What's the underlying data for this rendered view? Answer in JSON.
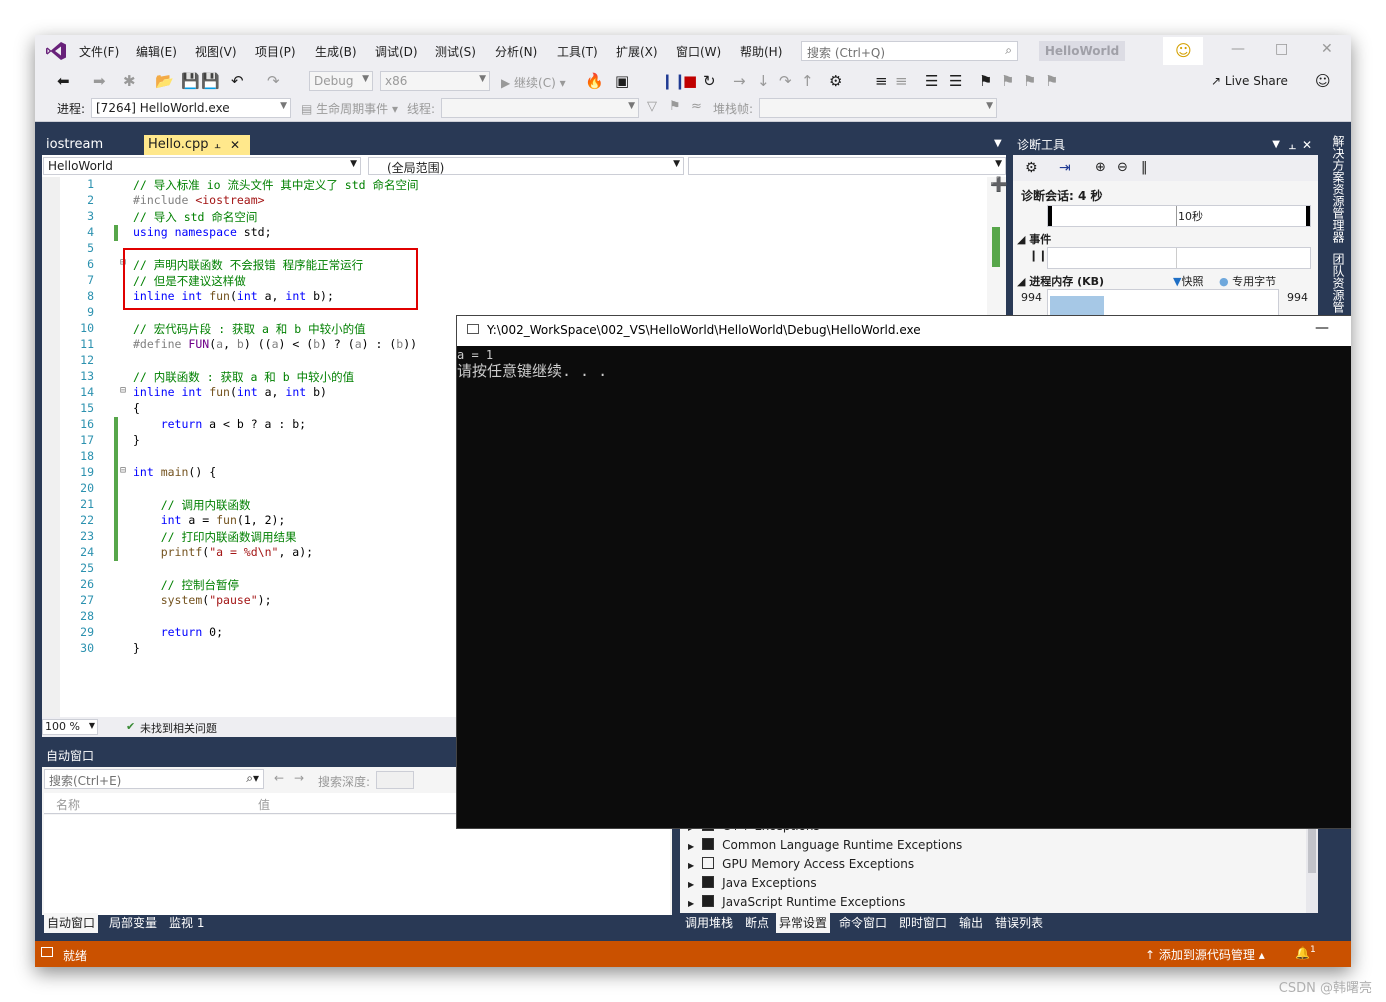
{
  "menu": [
    "文件(F)",
    "编辑(E)",
    "视图(V)",
    "项目(P)",
    "生成(B)",
    "调试(D)",
    "测试(S)",
    "分析(N)",
    "工具(T)",
    "扩展(X)",
    "窗口(W)",
    "帮助(H)"
  ],
  "search": {
    "placeholder": "搜索 (Ctrl+Q)"
  },
  "solution_name": "HelloWorld",
  "toolbar": {
    "config": "Debug",
    "platform": "x86",
    "continue_label": "继续(C)",
    "live_share": "Live Share",
    "process_label": "进程:",
    "process_value": "[7264] HelloWorld.exe",
    "lifecycle_label": "生命周期事件",
    "thread_label": "线程:",
    "stackframe_label": "堆栈帧:"
  },
  "editor": {
    "tabs": [
      "iostream",
      "Hello.cpp"
    ],
    "nav_project": "HelloWorld",
    "nav_scope": "(全局范围)",
    "zoom": "100 %",
    "issues": "未找到相关问题",
    "lines": [
      {
        "n": "1",
        "t": "// 导入标准 io 流头文件 其中定义了 std 命名空间"
      },
      {
        "n": "2",
        "t": "#include <iostream>"
      },
      {
        "n": "3",
        "t": "// 导入 std 命名空间"
      },
      {
        "n": "4",
        "t": "using namespace std;"
      },
      {
        "n": "5",
        "t": ""
      },
      {
        "n": "6",
        "t": "// 声明内联函数 不会报错 程序能正常运行"
      },
      {
        "n": "7",
        "t": "// 但是不建议这样做"
      },
      {
        "n": "8",
        "t": "inline int fun(int a, int b);"
      },
      {
        "n": "9",
        "t": ""
      },
      {
        "n": "10",
        "t": "// 宏代码片段 : 获取 a 和 b 中较小的值"
      },
      {
        "n": "11",
        "t": "#define FUN(a, b) ((a) < (b) ? (a) : (b))"
      },
      {
        "n": "12",
        "t": ""
      },
      {
        "n": "13",
        "t": "// 内联函数 : 获取 a 和 b 中较小的值"
      },
      {
        "n": "14",
        "t": "inline int fun(int a, int b)"
      },
      {
        "n": "15",
        "t": "{"
      },
      {
        "n": "16",
        "t": "    return a < b ? a : b;"
      },
      {
        "n": "17",
        "t": "}"
      },
      {
        "n": "18",
        "t": ""
      },
      {
        "n": "19",
        "t": "int main() {"
      },
      {
        "n": "20",
        "t": ""
      },
      {
        "n": "21",
        "t": "    // 调用内联函数"
      },
      {
        "n": "22",
        "t": "    int a = fun(1, 2);"
      },
      {
        "n": "23",
        "t": "    // 打印内联函数调用结果"
      },
      {
        "n": "24",
        "t": "    printf(\"a = %d\\n\", a);"
      },
      {
        "n": "25",
        "t": ""
      },
      {
        "n": "26",
        "t": "    // 控制台暂停"
      },
      {
        "n": "27",
        "t": "    system(\"pause\");"
      },
      {
        "n": "28",
        "t": ""
      },
      {
        "n": "29",
        "t": "    return 0;"
      },
      {
        "n": "30",
        "t": "}"
      }
    ]
  },
  "autos": {
    "title": "自动窗口",
    "search": "搜索(Ctrl+E)",
    "depth_label": "搜索深度:",
    "col_name": "名称",
    "col_value": "值",
    "tabs": [
      "自动窗口",
      "局部变量",
      "监视 1"
    ]
  },
  "exceptions": {
    "rows": [
      {
        "label": "C++ Exceptions",
        "checked": true
      },
      {
        "label": "Common Language Runtime Exceptions",
        "checked": true
      },
      {
        "label": "GPU Memory Access Exceptions",
        "checked": false
      },
      {
        "label": "Java Exceptions",
        "checked": true
      },
      {
        "label": "JavaScript Runtime Exceptions",
        "checked": true
      }
    ],
    "tabs": [
      "调用堆栈",
      "断点",
      "异常设置",
      "命令窗口",
      "即时窗口",
      "输出",
      "错误列表"
    ]
  },
  "diagnostics": {
    "title": "诊断工具",
    "session": "诊断会话: 4 秒",
    "tick": "10秒",
    "events": "事件",
    "memory": "进程内存 (KB)",
    "snapshot": "快照",
    "private_bytes": "专用字节",
    "mem_left": "994",
    "mem_right": "994"
  },
  "sidebar": [
    "解决方案资源管理器",
    "团队资源管"
  ],
  "console": {
    "title": "Y:\\002_WorkSpace\\002_VS\\HelloWorld\\HelloWorld\\Debug\\HelloWorld.exe",
    "line1": "a = 1",
    "line2": "请按任意键继续. . ."
  },
  "status": {
    "ready": "就绪",
    "source_control": "添加到源代码管理",
    "notif_count": "1"
  },
  "watermark": "CSDN @韩曙亮",
  "colors": {
    "statusbar": "#ca5100",
    "highlight_box": "#e00000",
    "frame": "#293955"
  }
}
